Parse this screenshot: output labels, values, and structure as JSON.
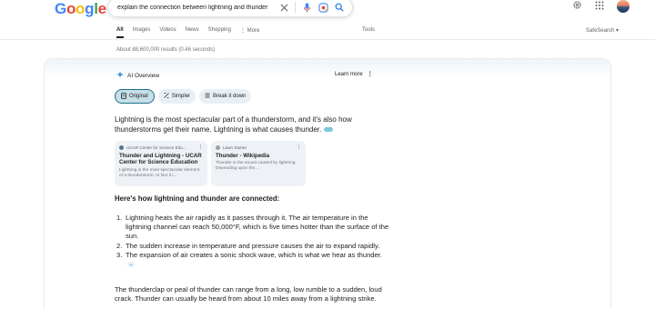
{
  "header": {
    "logo": "Google",
    "query": "explain the connection between lightning and thunder"
  },
  "tabs": [
    "All",
    "Images",
    "Videos",
    "News",
    "Shopping",
    "⋮ More"
  ],
  "tools_label": "Tools",
  "safesearch_label": "SafeSearch ▾",
  "results_info": "About 88,600,000 results (0.46 seconds)",
  "ai_overview": {
    "title": "AI Overview",
    "learn_more": "Learn more",
    "chips": [
      "Original",
      "Simpler",
      "Break it down"
    ],
    "intro": "Lightning is the most spectacular part of a thunderstorm, and it's also how thunderstorms get their name. Lightning is what causes thunder.",
    "sources": [
      {
        "site": "UCAR Center for Science Edu...",
        "title": "Thunder and Lightning - UCAR Center for Science Education",
        "snippet": "Lightning is the most spectacular element of a thunderstorm. In fact it i..."
      },
      {
        "site": "Lawn Starter",
        "title": "Thunder - Wikipedia",
        "snippet": "Thunder is the sound caused by lightning. Depending upon the..."
      }
    ],
    "subheading": "Here's how lightning and thunder are connected:",
    "list": [
      "Lightning heats the air rapidly as it passes through it. The air temperature in the lightning channel can reach 50,000°F, which is five times hotter than the surface of the sun.",
      "The sudden increase in temperature and pressure causes the air to expand rapidly.",
      "The expansion of air creates a sonic shock wave, which is what we hear as thunder."
    ],
    "closing": "The thunderclap or peal of thunder can range from a long, low rumble to a sudden, loud crack. Thunder can usually be heard from about 10 miles away from a lightning strike."
  },
  "colors": {
    "accent": "#1f6f8b",
    "chip_bg": "#e8f0f5",
    "card_bg": "#eef2f6"
  }
}
